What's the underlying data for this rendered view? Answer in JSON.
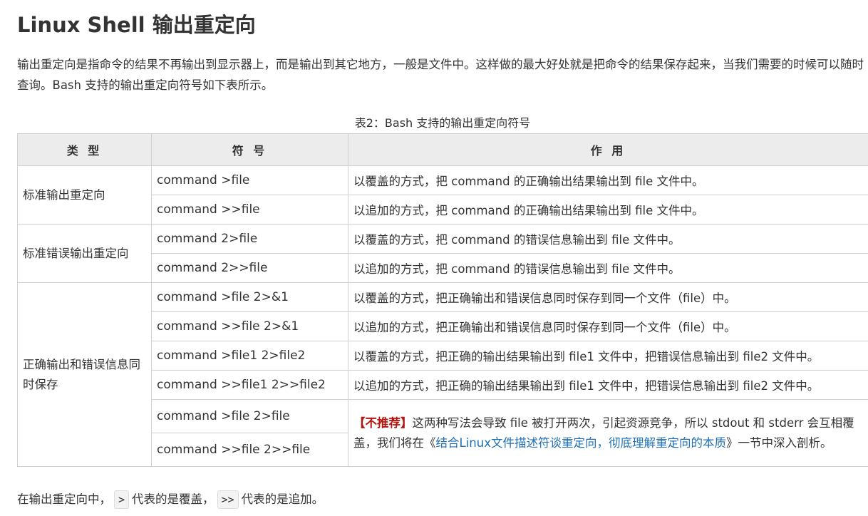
{
  "title": "Linux Shell 输出重定向",
  "intro": "输出重定向是指命令的结果不再输出到显示器上，而是输出到其它地方，一般是文件中。这样做的最大好处就是把命令的结果保存起来，当我们需要的时候可以随时查询。Bash 支持的输出重定向符号如下表所示。",
  "table": {
    "caption": "表2：Bash 支持的输出重定向符号",
    "headers": [
      "类 型",
      "符 号",
      "作 用"
    ],
    "groups": [
      {
        "type": "标准输出重定向",
        "rows": [
          {
            "symbol": "command >file",
            "desc": "以覆盖的方式，把 command 的正确输出结果输出到 file 文件中。"
          },
          {
            "symbol": "command >>file",
            "desc": "以追加的方式，把 command 的正确输出结果输出到 file 文件中。"
          }
        ]
      },
      {
        "type": "标准错误输出重定向",
        "rows": [
          {
            "symbol": "command 2>file",
            "desc": "以覆盖的方式，把 command 的错误信息输出到 file 文件中。"
          },
          {
            "symbol": "command 2>>file",
            "desc": "以追加的方式，把 command 的错误信息输出到 file 文件中。"
          }
        ]
      },
      {
        "type": "正确输出和错误信息同时保存",
        "rows": [
          {
            "symbol": "command >file 2>&1",
            "desc": "以覆盖的方式，把正确输出和错误信息同时保存到同一个文件（file）中。"
          },
          {
            "symbol": "command >>file 2>&1",
            "desc": "以追加的方式，把正确输出和错误信息同时保存到同一个文件（file）中。"
          },
          {
            "symbol": "command >file1 2>file2",
            "desc": "以覆盖的方式，把正确的输出结果输出到 file1 文件中，把错误信息输出到 file2 文件中。"
          },
          {
            "symbol": "command >>file1  2>>file2",
            "desc": "以追加的方式，把正确的输出结果输出到 file1 文件中，把错误信息输出到 file2 文件中。"
          },
          {
            "symbol": "command >file 2>file"
          },
          {
            "symbol": "command >>file 2>>file"
          }
        ],
        "note": {
          "label": "【不推荐】",
          "text_before": "这两种写法会导致 file 被打开两次，引起资源竞争，所以 stdout 和 stderr 会互相覆盖，我们将在",
          "link_open": "《",
          "link_text": "结合Linux文件描述符谈重定向，彻底理解重定向的本质",
          "link_close": "》",
          "text_after": "一节中深入剖析。"
        }
      }
    ]
  },
  "outro": {
    "prefix": "在输出重定向中，",
    "code1": ">",
    "middle": "代表的是覆盖，",
    "code2": ">>",
    "suffix": "代表的是追加。"
  },
  "colors": {
    "text": "#333333",
    "header_bg": "#ececec",
    "border": "#d0d0d0",
    "warning": "#b3160f",
    "link": "#1f6fb5"
  }
}
